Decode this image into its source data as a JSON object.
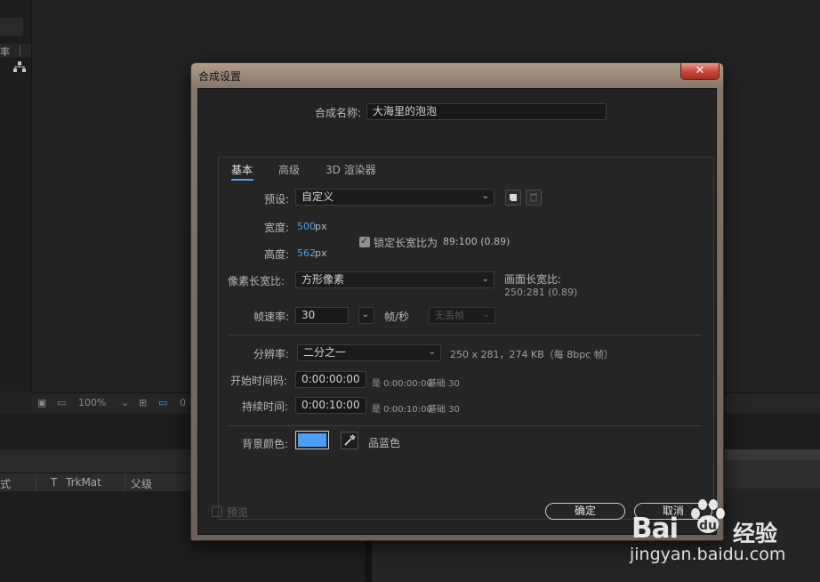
{
  "background": {
    "panel_tab_label": "率",
    "viewer_zoom": "100%",
    "viewer_cut": "0",
    "columns": [
      "式",
      "T",
      "TrkMat",
      "父级"
    ]
  },
  "dialog": {
    "title": "合成设置",
    "close_glyph": "✕",
    "comp_name_label": "合成名称:",
    "comp_name_value": "大海里的泡泡",
    "tabs": [
      {
        "label": "基本",
        "active": true
      },
      {
        "label": "高级",
        "active": false
      },
      {
        "label": "3D 渲染器",
        "active": false
      }
    ],
    "preset": {
      "label": "预设:",
      "value": "自定义"
    },
    "width": {
      "label": "宽度:",
      "value": "500",
      "unit": "px"
    },
    "height": {
      "label": "高度:",
      "value": "562",
      "unit": "px"
    },
    "lock_aspect": {
      "label": "锁定长宽比为",
      "ratio": "89:100 (0.89)",
      "checked": true
    },
    "pixel_aspect": {
      "label": "像素长宽比:",
      "value": "方形像素"
    },
    "frame_aspect": {
      "label": "画面长宽比:",
      "value": "250:281 (0.89)"
    },
    "frame_rate": {
      "label": "帧速率:",
      "value": "30",
      "unit": "帧/秒",
      "drop_frame": "无丢帧"
    },
    "resolution": {
      "label": "分辨率:",
      "value": "二分之一",
      "info": "250 x 281，274 KB（每 8bpc 帧）"
    },
    "start_timecode": {
      "label": "开始时间码:",
      "value": "0:00:00:00",
      "note": "是 0:00:00:00",
      "base": "基础 30"
    },
    "duration": {
      "label": "持续时间:",
      "value": "0:00:10:00",
      "note": "是 0:00:10:00",
      "base": "基础 30"
    },
    "bg_color": {
      "label": "背景颜色:",
      "color": "#47a0f5",
      "name": "品蓝色"
    },
    "preview_label": "预览",
    "ok_label": "确定",
    "cancel_label": "取消"
  },
  "watermark": {
    "brand": "Bai",
    "brand2": "经验",
    "url": "jingyan.baidu.com"
  }
}
